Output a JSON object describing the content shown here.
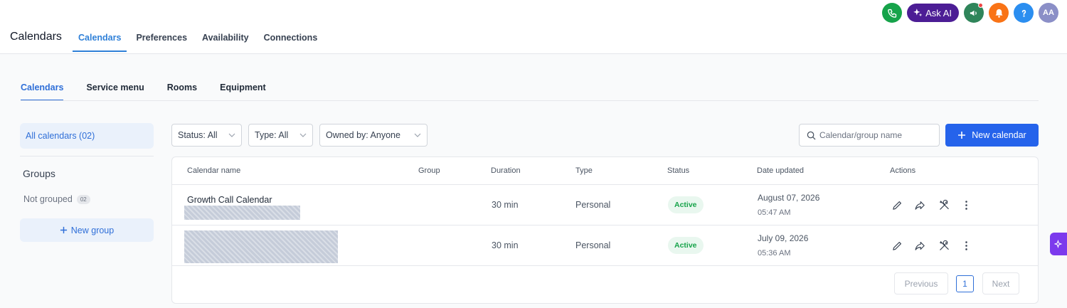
{
  "header": {
    "title": "Calendars",
    "tabs": [
      {
        "label": "Calendars",
        "active": true
      },
      {
        "label": "Preferences"
      },
      {
        "label": "Availability"
      },
      {
        "label": "Connections"
      }
    ],
    "ask_ai_label": "Ask AI",
    "avatar_initials": "AA",
    "colors": {
      "phone": "#16a34a",
      "ask_ai": "#4c1d95",
      "announce": "#2f855a",
      "bell": "#f97316",
      "help": "#2b8ef0"
    }
  },
  "subtabs": [
    {
      "label": "Calendars",
      "active": true
    },
    {
      "label": "Service menu"
    },
    {
      "label": "Rooms"
    },
    {
      "label": "Equipment"
    }
  ],
  "sidebar": {
    "all_calendars_label": "All calendars (02)",
    "groups_title": "Groups",
    "not_grouped_label": "Not grouped",
    "not_grouped_count": "02",
    "new_group_label": "New group"
  },
  "filters": {
    "status": "Status: All",
    "type": "Type: All",
    "owner": "Owned by: Anyone"
  },
  "search": {
    "placeholder": "Calendar/group name"
  },
  "new_calendar_label": "New calendar",
  "table": {
    "columns": [
      "Calendar name",
      "Group",
      "Duration",
      "Type",
      "Status",
      "Date updated",
      "Actions"
    ],
    "rows": [
      {
        "name": "Growth Call Calendar",
        "group": "",
        "duration": "30 min",
        "type": "Personal",
        "status": "Active",
        "date": "August 07, 2026",
        "time": "05:47 AM"
      },
      {
        "name": "",
        "group": "",
        "duration": "30 min",
        "type": "Personal",
        "status": "Active",
        "date": "July 09, 2026",
        "time": "05:36 AM"
      }
    ]
  },
  "pagination": {
    "previous": "Previous",
    "page": "1",
    "next": "Next"
  },
  "accent": "#2563eb"
}
